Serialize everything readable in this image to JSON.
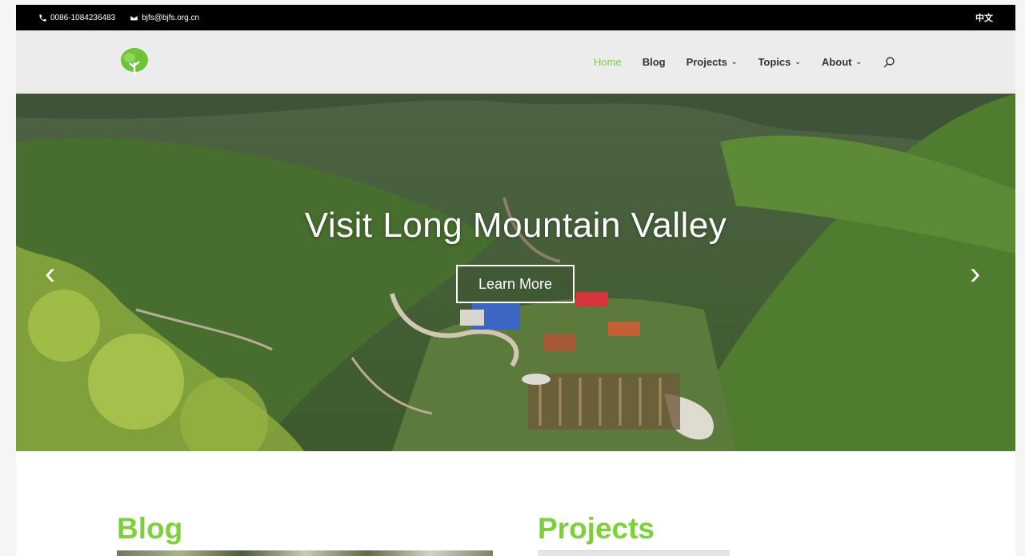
{
  "topbar": {
    "phone": "0086-1084236483",
    "email": "bjfs@bjfs.org.cn",
    "language": "中文"
  },
  "nav": {
    "items": [
      {
        "label": "Home",
        "active": true,
        "has_dropdown": false
      },
      {
        "label": "Blog",
        "active": false,
        "has_dropdown": false
      },
      {
        "label": "Projects",
        "active": false,
        "has_dropdown": true
      },
      {
        "label": "Topics",
        "active": false,
        "has_dropdown": true
      },
      {
        "label": "About",
        "active": false,
        "has_dropdown": true
      }
    ],
    "search_icon": "search-icon"
  },
  "hero": {
    "title": "Visit Long Mountain Valley",
    "button_label": "Learn More",
    "prev_arrow": "‹",
    "next_arrow": "›"
  },
  "sections": {
    "blog_title": "Blog",
    "projects_title": "Projects"
  },
  "colors": {
    "accent": "#7cd13b",
    "topbar_bg": "#000000",
    "header_bg": "#ececec"
  }
}
